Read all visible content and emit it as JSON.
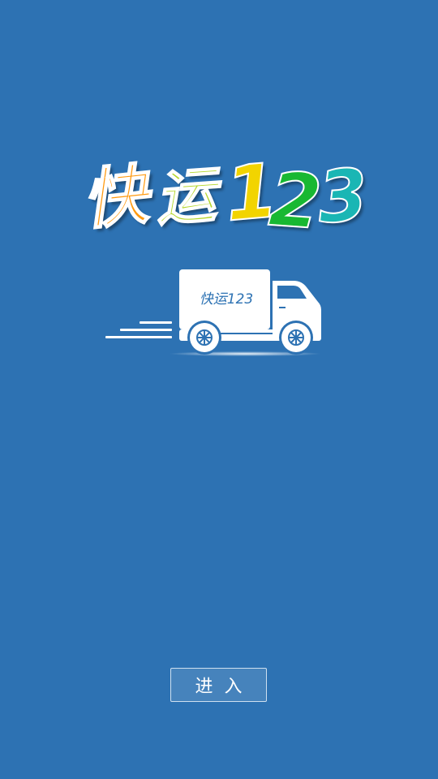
{
  "logo": {
    "chars": [
      "快",
      "运",
      "1",
      "2",
      "3"
    ],
    "colors": [
      "#ff9a10",
      "#b4d62a",
      "#f2d400",
      "#18b832",
      "#1ab6b4"
    ]
  },
  "truck": {
    "label": "快运123",
    "icon": "truck-icon"
  },
  "enter_button": {
    "label": "进入"
  },
  "colors": {
    "background": "#2d72b3",
    "truck": "#ffffff"
  }
}
